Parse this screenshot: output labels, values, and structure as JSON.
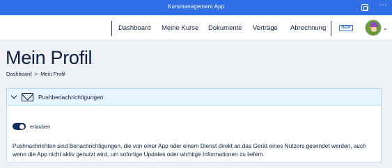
{
  "window": {
    "title": "Kursmanagement App",
    "icons": [
      "window-layout-icon",
      "more-icon"
    ],
    "more_glyph": "···"
  },
  "nav": {
    "items": [
      "Dashboard",
      "Meine Kurse",
      "Dokumente",
      "Verträge",
      "Abrechnung"
    ],
    "badge": "NEW",
    "avatar_caret": "⌄"
  },
  "page": {
    "title": "Mein Profil",
    "breadcrumb": [
      "Dashboard",
      ">",
      "Mein Profil"
    ]
  },
  "panel": {
    "title": "Pushbenachrichtigungen",
    "toggle_label": "erlauben",
    "toggle_on": true,
    "description": "Pushnachrichten sind Benachrichtigungen, die von einer App oder einem Dienst direkt an das Gerät eines Nutzers gesendet werden, auch wenn die App nicht aktiv genutzt wird, um sofortige Updates oder wichtige Informationen zu liefern."
  },
  "colors": {
    "accent": "#2f6ee6",
    "text": "#0e1f3f",
    "toggle_on": "#0e2a55",
    "panel_header": "#e6f4fd"
  }
}
